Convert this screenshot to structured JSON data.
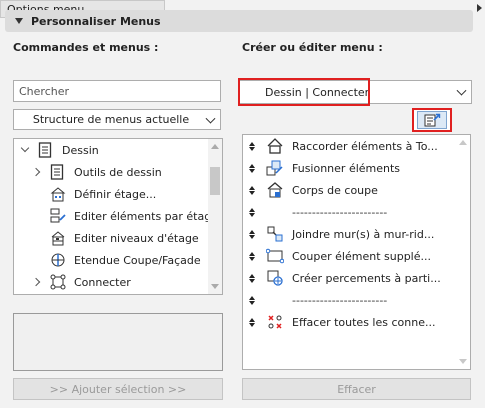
{
  "header": {
    "title": "Personnaliser Menus"
  },
  "left": {
    "title": "Commandes et menus :",
    "search_placeholder": "Chercher",
    "structure_select": "Structure de menus actuelle",
    "tree": [
      {
        "label": "Dessin",
        "icon": "doc-icon",
        "expander": "expanded",
        "level": 0
      },
      {
        "label": "Outils de dessin",
        "icon": "doc-icon",
        "expander": "collapsed",
        "level": 1
      },
      {
        "label": "Définir étage...",
        "icon": "building-icon",
        "expander": "none",
        "level": 1
      },
      {
        "label": "Editer éléments par étages...",
        "icon": "stack-edit-icon",
        "expander": "none",
        "level": 1
      },
      {
        "label": "Editer niveaux d'étage",
        "icon": "levels-icon",
        "expander": "none",
        "level": 1
      },
      {
        "label": "Etendue Coupe/Façade",
        "icon": "section-icon",
        "expander": "none",
        "level": 1
      },
      {
        "label": "Connecter",
        "icon": "connect-icon",
        "expander": "collapsed",
        "level": 1
      },
      {
        "label": "",
        "icon": "doc-icon",
        "expander": "collapsed",
        "level": 1
      }
    ],
    "add_button": ">> Ajouter sélection >>"
  },
  "right": {
    "title": "Créer ou éditer menu :",
    "menu_select": "Dessin | Connecter",
    "options_label": "Options menu",
    "items": [
      {
        "label": "Raccorder éléments à To...",
        "icon": "house-trim-icon"
      },
      {
        "label": "Fusionner éléments",
        "icon": "merge-icon"
      },
      {
        "label": "Corps de coupe",
        "icon": "cutting-body-icon"
      },
      {
        "label": "------------------------",
        "icon": ""
      },
      {
        "label": "Joindre mur(s) à mur-rid...",
        "icon": "wall-join-icon"
      },
      {
        "label": "Couper élément supplé...",
        "icon": "split-icon"
      },
      {
        "label": "Créer percements à parti...",
        "icon": "hole-icon"
      },
      {
        "label": "------------------------",
        "icon": ""
      },
      {
        "label": "Effacer toutes les conne...",
        "icon": "delete-connections-icon"
      }
    ],
    "delete_button": "Effacer"
  },
  "colors": {
    "highlight": "#e02020",
    "accent": "#2a6fd1"
  }
}
